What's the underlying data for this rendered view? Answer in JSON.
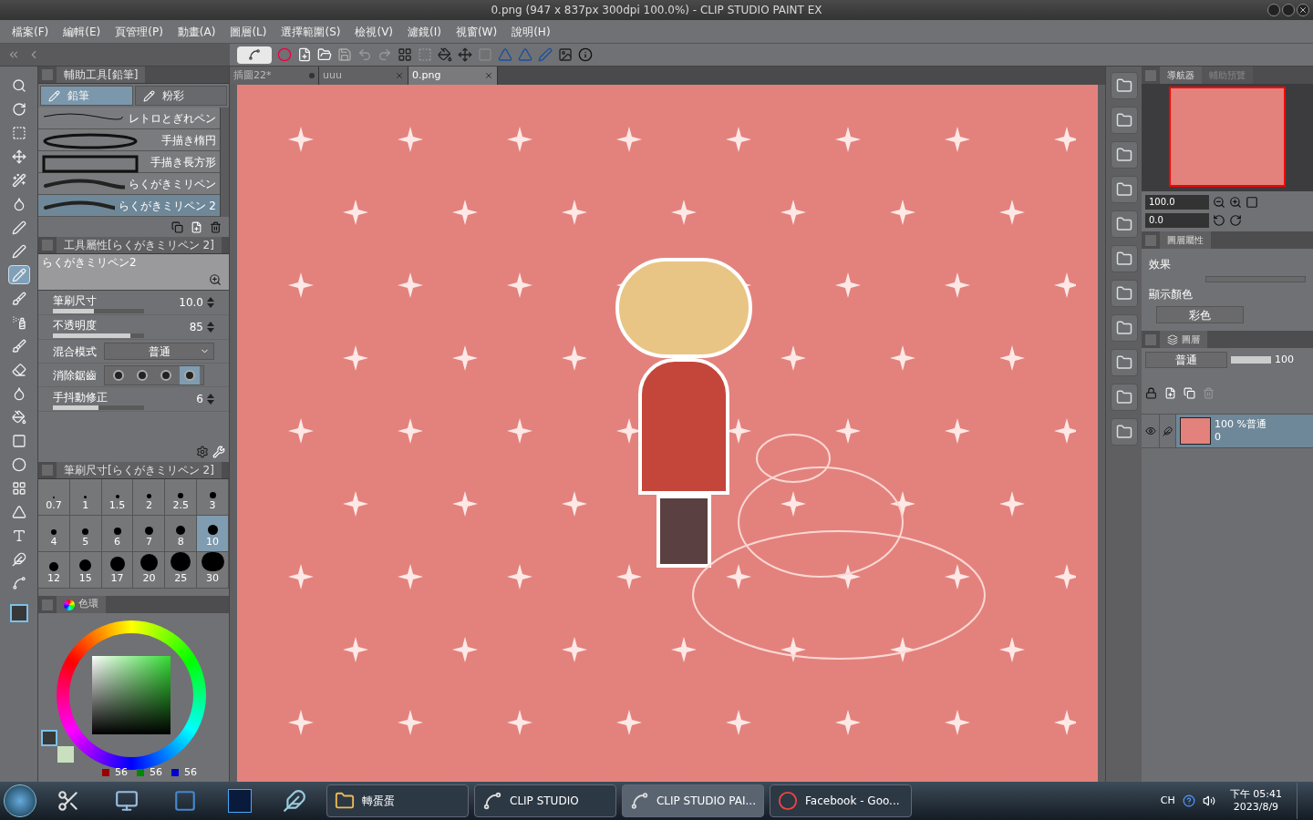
{
  "window": {
    "title": "0.png (947 x 837px 300dpi 100.0%)  - CLIP STUDIO PAINT EX"
  },
  "menu": [
    "檔案(F)",
    "編輯(E)",
    "頁管理(P)",
    "動畫(A)",
    "圖層(L)",
    "選擇範圍(S)",
    "檢視(V)",
    "濾鏡(I)",
    "視窗(W)",
    "說明(H)"
  ],
  "document_tabs": [
    {
      "label": "插圖22*",
      "kind": "unsaved",
      "selected": false
    },
    {
      "label": "uuu",
      "kind": "closable",
      "selected": false
    },
    {
      "label": "0.png",
      "kind": "closable",
      "selected": true
    }
  ],
  "tools": [
    {
      "selected": false
    },
    {
      "selected": false
    },
    {
      "selected": false
    },
    {
      "selected": false
    },
    {
      "selected": false
    },
    {
      "selected": false
    },
    {
      "selected": false
    },
    {
      "selected": false
    },
    {
      "selected": true
    },
    {
      "selected": false
    },
    {
      "selected": false
    },
    {
      "selected": false
    },
    {
      "selected": false
    },
    {
      "selected": false
    },
    {
      "selected": false
    },
    {
      "selected": false
    },
    {
      "selected": false
    },
    {
      "selected": false
    },
    {
      "selected": false
    },
    {
      "selected": false
    },
    {
      "selected": false
    },
    {
      "selected": false
    }
  ],
  "subtool_panel": {
    "title": "輔助工具[鉛筆]",
    "groups": [
      {
        "label": "鉛筆",
        "selected": true
      },
      {
        "label": "粉彩",
        "selected": false
      }
    ],
    "brushes": [
      {
        "name": "レトロとぎれペン",
        "kind": "line",
        "selected": false
      },
      {
        "name": "手描き楕円",
        "kind": "ellipse",
        "selected": false
      },
      {
        "name": "手描き長方形",
        "kind": "rect",
        "selected": false
      },
      {
        "name": "らくがきミリペン",
        "kind": "stroke",
        "selected": false
      },
      {
        "name": "らくがきミリペン 2",
        "kind": "stroke",
        "selected": true
      }
    ]
  },
  "tool_property": {
    "title": "工具屬性[らくがきミリペン 2]",
    "preview_name": "らくがきミリペン2",
    "properties": [
      {
        "kind": "slider",
        "label": "筆刷尺寸",
        "value": "10.0",
        "level": 0.45
      },
      {
        "kind": "slider",
        "label": "不透明度",
        "value": "85",
        "level": 0.85
      },
      {
        "kind": "select",
        "label": "混合模式",
        "value": "普通"
      },
      {
        "kind": "antialias",
        "label": "消除鋸齒",
        "options": [
          {
            "selected": false
          },
          {
            "selected": false
          },
          {
            "selected": false
          },
          {
            "selected": true
          }
        ]
      },
      {
        "kind": "slider",
        "label": "手抖動修正",
        "value": "6",
        "level": 0.5
      }
    ]
  },
  "brush_size_panel": {
    "title": "筆刷尺寸[らくがきミリペン 2]",
    "sizes": [
      {
        "label": "0.7",
        "selected": false
      },
      {
        "label": "1",
        "selected": false
      },
      {
        "label": "1.5",
        "selected": false
      },
      {
        "label": "2",
        "selected": false
      },
      {
        "label": "2.5",
        "selected": false
      },
      {
        "label": "3",
        "selected": false
      },
      {
        "label": "4",
        "selected": false
      },
      {
        "label": "5",
        "selected": false
      },
      {
        "label": "6",
        "selected": false
      },
      {
        "label": "7",
        "selected": false
      },
      {
        "label": "8",
        "selected": false
      },
      {
        "label": "10",
        "selected": true
      },
      {
        "label": "12",
        "selected": false
      },
      {
        "label": "15",
        "selected": false
      },
      {
        "label": "17",
        "selected": false
      },
      {
        "label": "20",
        "selected": false
      },
      {
        "label": "25",
        "selected": false
      },
      {
        "label": "30",
        "selected": false
      }
    ]
  },
  "color_panel": {
    "tab": "色環",
    "rgb": [
      "56",
      "56",
      "56"
    ]
  },
  "navigator": {
    "tabs": [
      {
        "label": "導航器",
        "selected": true
      },
      {
        "label": "輔助預覽",
        "selected": false
      }
    ],
    "zoom": "100.0",
    "rotation": "0.0"
  },
  "layer_property": {
    "tabs": [
      {
        "label": "圖層屬性",
        "selected": true
      }
    ],
    "effect_label": "效果",
    "display_color_label": "顯示顏色",
    "display_color": "彩色"
  },
  "layers": {
    "tab": "圖層",
    "blend_mode": "普通",
    "opacity": {
      "value": "100",
      "level": 1
    },
    "items": [
      {
        "name": "100 %普通",
        "sub": "0",
        "visible": true,
        "selected": true
      }
    ]
  },
  "taskbar": {
    "items": [
      {
        "label": "轉蛋蛋",
        "kind": "folder",
        "selected": false
      },
      {
        "label": "CLIP STUDIO",
        "kind": "clip",
        "selected": false
      },
      {
        "label": "CLIP STUDIO PAI...",
        "kind": "clip",
        "selected": true
      },
      {
        "label": "Facebook - Goo...",
        "kind": "browser",
        "selected": false
      }
    ],
    "language": "CH",
    "time": "下午 05:41",
    "date": "2023/8/9"
  }
}
